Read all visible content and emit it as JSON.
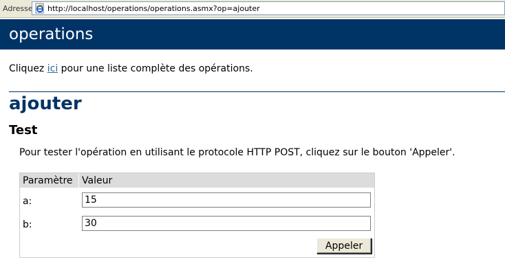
{
  "browser": {
    "address_label": "Adresse",
    "url": "http://localhost/operations/operations.asmx?op=ajouter"
  },
  "header": {
    "title": "operations"
  },
  "intro": {
    "prefix": "Cliquez ",
    "link_text": "ici",
    "suffix": " pour une liste complète des opérations."
  },
  "operation": {
    "name": "ajouter"
  },
  "test": {
    "title": "Test",
    "instruction": "Pour tester l'opération en utilisant le protocole HTTP POST, cliquez sur le bouton 'Appeler'.",
    "table": {
      "header_param": "Paramètre",
      "header_value": "Valeur"
    },
    "params": [
      {
        "label": "a:",
        "value": "15"
      },
      {
        "label": "b:",
        "value": "30"
      }
    ],
    "submit_label": "Appeler"
  },
  "colors": {
    "brand": "#003366",
    "link": "#336699",
    "table_header": "#dcdcdc"
  },
  "icons": {
    "address_page": "ie-page-icon"
  }
}
